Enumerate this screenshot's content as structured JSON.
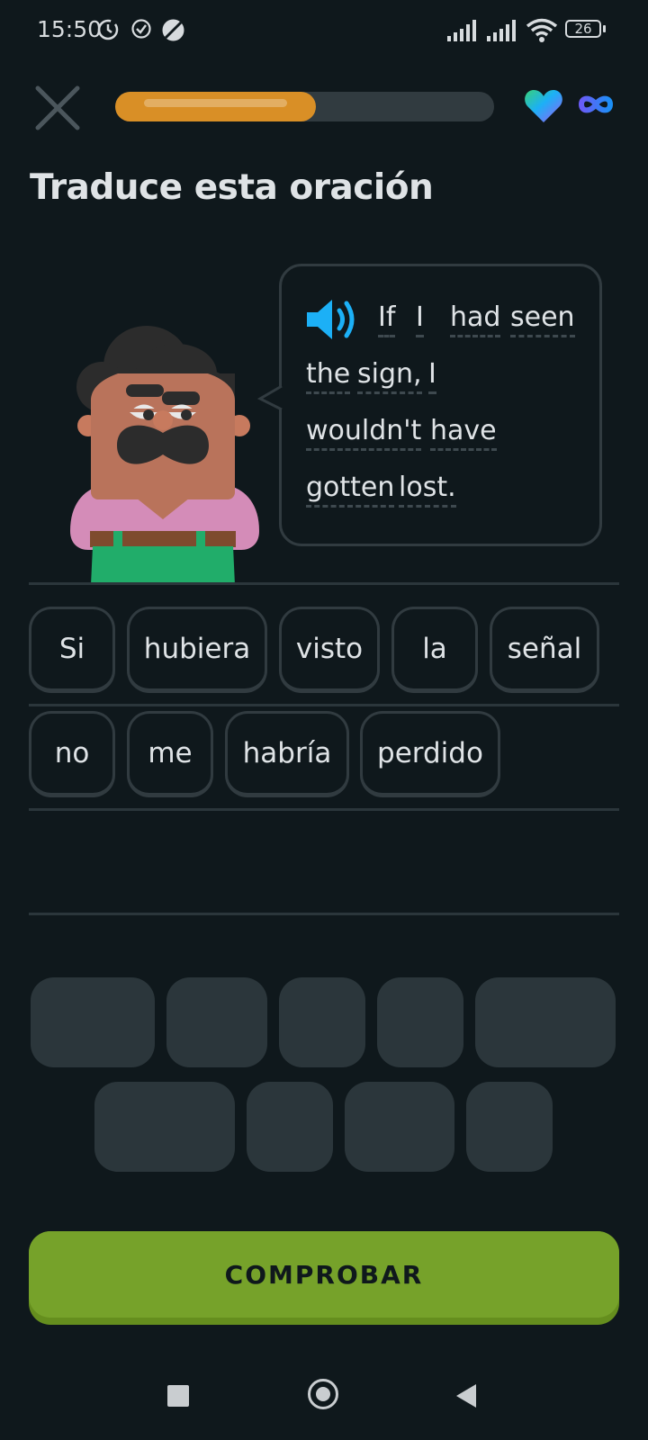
{
  "status_bar": {
    "time": "15:50",
    "battery": "26",
    "icons": [
      "data-saver-icon",
      "check-circle-icon",
      "dnd-icon",
      "signal-icon",
      "signal-icon",
      "wifi-icon",
      "battery-icon"
    ]
  },
  "lesson": {
    "progress_fraction": 0.53,
    "hearts": "infinity-icon",
    "title": "Traduce esta oración"
  },
  "prompt": {
    "words": [
      "If",
      "I",
      "had",
      "seen",
      "the",
      "sign,",
      "I",
      "wouldn't",
      "have",
      "gotten",
      "lost."
    ]
  },
  "answer": {
    "row1": [
      "Si",
      "hubiera",
      "visto",
      "la",
      "señal"
    ],
    "row2": [
      "no",
      "me",
      "habría",
      "perdido"
    ]
  },
  "check_button": {
    "label": "COMPROBAR"
  },
  "colors": {
    "background": "#0f181c",
    "progress": "#d98f26",
    "button": "#76a22a",
    "speaker": "#1cb0f6"
  }
}
